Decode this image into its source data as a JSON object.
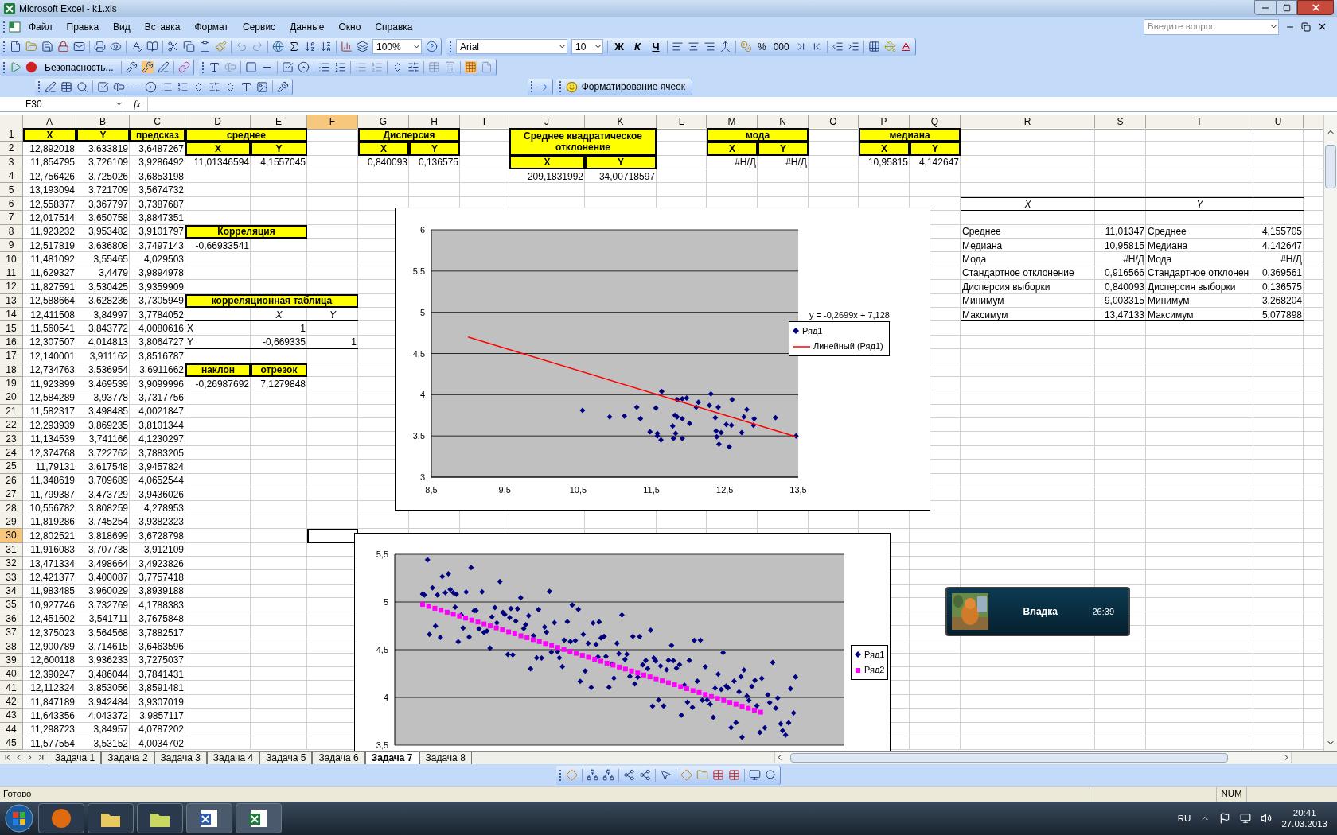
{
  "window": {
    "title": "Microsoft Excel - k1.xls"
  },
  "menu": [
    "Файл",
    "Правка",
    "Вид",
    "Вставка",
    "Формат",
    "Сервис",
    "Данные",
    "Окно",
    "Справка"
  ],
  "help_field": {
    "placeholder": "Введите вопрос"
  },
  "toolbar": {
    "zoom": "100%",
    "font": "Arial",
    "font_size": "10",
    "format_buttons": [
      "Ж",
      "К",
      "Ч"
    ],
    "number_buttons": [
      "%",
      "000"
    ],
    "security": "Безопасность...",
    "task_pane": "Форматирование ячеек"
  },
  "formula_bar": {
    "name_box": "F30",
    "label": "fx"
  },
  "columns": [
    {
      "label": "A",
      "selected": false
    },
    {
      "label": "B",
      "selected": false
    },
    {
      "label": "C",
      "selected": false
    },
    {
      "label": "D",
      "selected": false
    },
    {
      "label": "E",
      "selected": false
    },
    {
      "label": "F",
      "selected": true
    },
    {
      "label": "G",
      "selected": false
    },
    {
      "label": "H",
      "selected": false
    },
    {
      "label": "I",
      "selected": false
    },
    {
      "label": "J",
      "selected": false
    },
    {
      "label": "K",
      "selected": false
    },
    {
      "label": "L",
      "selected": false
    },
    {
      "label": "M",
      "selected": false
    },
    {
      "label": "N",
      "selected": false
    },
    {
      "label": "O",
      "selected": false
    },
    {
      "label": "P",
      "selected": false
    },
    {
      "label": "Q",
      "selected": false
    },
    {
      "label": "R",
      "selected": false
    },
    {
      "label": "S",
      "selected": false
    },
    {
      "label": "T",
      "selected": false
    },
    {
      "label": "U",
      "selected": false
    }
  ],
  "row_numbers": [
    {
      "label": "1",
      "selected": false
    },
    {
      "label": "2",
      "selected": false
    },
    {
      "label": "3",
      "selected": false
    },
    {
      "label": "4",
      "selected": false
    },
    {
      "label": "5",
      "selected": false
    },
    {
      "label": "6",
      "selected": false
    },
    {
      "label": "7",
      "selected": false
    },
    {
      "label": "8",
      "selected": false
    },
    {
      "label": "9",
      "selected": false
    },
    {
      "label": "10",
      "selected": false
    },
    {
      "label": "11",
      "selected": false
    },
    {
      "label": "12",
      "selected": false
    },
    {
      "label": "13",
      "selected": false
    },
    {
      "label": "14",
      "selected": false
    },
    {
      "label": "15",
      "selected": false
    },
    {
      "label": "16",
      "selected": false
    },
    {
      "label": "17",
      "selected": false
    },
    {
      "label": "18",
      "selected": false
    },
    {
      "label": "19",
      "selected": false
    },
    {
      "label": "20",
      "selected": false
    },
    {
      "label": "21",
      "selected": false
    },
    {
      "label": "22",
      "selected": false
    },
    {
      "label": "23",
      "selected": false
    },
    {
      "label": "24",
      "selected": false
    },
    {
      "label": "25",
      "selected": false
    },
    {
      "label": "26",
      "selected": false
    },
    {
      "label": "27",
      "selected": false
    },
    {
      "label": "28",
      "selected": false
    },
    {
      "label": "29",
      "selected": false
    },
    {
      "label": "30",
      "selected": true
    },
    {
      "label": "31",
      "selected": false
    },
    {
      "label": "32",
      "selected": false
    },
    {
      "label": "33",
      "selected": false
    },
    {
      "label": "34",
      "selected": false
    },
    {
      "label": "35",
      "selected": false
    },
    {
      "label": "36",
      "selected": false
    },
    {
      "label": "37",
      "selected": false
    },
    {
      "label": "38",
      "selected": false
    },
    {
      "label": "39",
      "selected": false
    },
    {
      "label": "40",
      "selected": false
    },
    {
      "label": "41",
      "selected": false
    },
    {
      "label": "42",
      "selected": false
    },
    {
      "label": "43",
      "selected": false
    },
    {
      "label": "44",
      "selected": false
    },
    {
      "label": "45",
      "selected": false
    }
  ],
  "data_table": {
    "headers": [
      "X",
      "Y",
      "предсказ"
    ],
    "rows": [
      [
        "12,892018",
        "3,633819",
        "3,6487267"
      ],
      [
        "11,854795",
        "3,726109",
        "3,9286492"
      ],
      [
        "12,756426",
        "3,725026",
        "3,6853198"
      ],
      [
        "13,193094",
        "3,721709",
        "3,5674732"
      ],
      [
        "12,558377",
        "3,367797",
        "3,7387687"
      ],
      [
        "12,017514",
        "3,650758",
        "3,8847351"
      ],
      [
        "11,923232",
        "3,953482",
        "3,9101797"
      ],
      [
        "12,517819",
        "3,636808",
        "3,7497143"
      ],
      [
        "11,481092",
        "3,55465",
        "4,029503"
      ],
      [
        "11,629327",
        "3,4479",
        "3,9894978"
      ],
      [
        "11,827591",
        "3,530425",
        "3,9359909"
      ],
      [
        "12,588664",
        "3,628236",
        "3,7305949"
      ],
      [
        "12,411508",
        "3,84997",
        "3,7784052"
      ],
      [
        "11,560541",
        "3,843772",
        "4,0080616"
      ],
      [
        "12,307507",
        "4,014813",
        "3,8064727"
      ],
      [
        "12,140001",
        "3,911162",
        "3,8516787"
      ],
      [
        "12,734763",
        "3,536954",
        "3,6911662"
      ],
      [
        "11,923899",
        "3,469539",
        "3,9099996"
      ],
      [
        "12,584289",
        "3,93778",
        "3,7317756"
      ],
      [
        "11,582317",
        "3,498485",
        "4,0021847"
      ],
      [
        "12,293939",
        "3,869235",
        "3,8101344"
      ],
      [
        "11,134539",
        "3,741166",
        "4,1230297"
      ],
      [
        "12,374768",
        "3,722762",
        "3,7883205"
      ],
      [
        "11,79131",
        "3,617548",
        "3,9457824"
      ],
      [
        "11,348619",
        "3,709689",
        "4,0652544"
      ],
      [
        "11,799387",
        "3,473729",
        "3,9436026"
      ],
      [
        "10,556782",
        "3,808259",
        "4,278953"
      ],
      [
        "11,819286",
        "3,745254",
        "3,9382323"
      ],
      [
        "12,802521",
        "3,818699",
        "3,6728798"
      ],
      [
        "11,916083",
        "3,707738",
        "3,912109"
      ],
      [
        "13,471334",
        "3,498664",
        "3,4923826"
      ],
      [
        "12,421377",
        "3,400087",
        "3,7757418"
      ],
      [
        "11,983485",
        "3,960029",
        "3,8939188"
      ],
      [
        "10,927746",
        "3,732769",
        "4,1788383"
      ],
      [
        "12,451602",
        "3,541711",
        "3,7675848"
      ],
      [
        "12,375023",
        "3,564568",
        "3,7882517"
      ],
      [
        "12,900789",
        "3,714615",
        "3,6463596"
      ],
      [
        "12,600118",
        "3,936233",
        "3,7275037"
      ],
      [
        "12,390247",
        "3,486044",
        "3,7841431"
      ],
      [
        "12,112324",
        "3,853056",
        "3,8591481"
      ],
      [
        "11,847189",
        "3,942484",
        "3,9307019"
      ],
      [
        "11,643356",
        "4,043372",
        "3,9857117"
      ],
      [
        "11,298723",
        "3,84957",
        "4,0787202"
      ],
      [
        "11,577554",
        "3,53152",
        "4,0034702"
      ]
    ]
  },
  "mean": {
    "title": "среднее",
    "headers": [
      "X",
      "Y"
    ],
    "values": [
      "11,01346594",
      "4,1557045"
    ]
  },
  "variance": {
    "title": "Дисперсия",
    "headers": [
      "X",
      "Y"
    ],
    "values": [
      "0,840093",
      "0,136575"
    ]
  },
  "std_deviation": {
    "title": "Среднее квадратическое отклонение",
    "headers": [
      "X",
      "Y"
    ],
    "values": [
      "209,1831992",
      "34,00718597"
    ]
  },
  "mode": {
    "title": "мода",
    "headers": [
      "X",
      "Y"
    ],
    "values": [
      "#Н/Д",
      "#Н/Д"
    ]
  },
  "median": {
    "title": "медиана",
    "headers": [
      "X",
      "Y"
    ],
    "values": [
      "10,95815",
      "4,142647"
    ]
  },
  "correlation": {
    "title": "Корреляция",
    "value": "-0,66933541"
  },
  "correlation_table": {
    "title": "корреляционная таблица",
    "headers": [
      "X",
      "Y"
    ],
    "rows": [
      {
        "label": "X",
        "values": [
          "1"
        ]
      },
      {
        "label": "Y",
        "values": [
          "-0,669335",
          "1"
        ]
      }
    ]
  },
  "regression": {
    "headers": [
      "наклон",
      "отрезок"
    ],
    "values": [
      "-0,26987692",
      "7,1279848"
    ]
  },
  "stats_table": {
    "headers": [
      "X",
      "Y"
    ],
    "rows": [
      [
        "Среднее",
        "11,01347",
        "Среднее",
        "4,155705"
      ],
      [
        "Медиана",
        "10,95815",
        "Медиана",
        "4,142647"
      ],
      [
        "Мода",
        "#Н/Д",
        "Мода",
        "#Н/Д"
      ],
      [
        "Стандартное отклонение",
        "0,916566",
        "Стандартное отклонен",
        "0,369561"
      ],
      [
        "Дисперсия выборки",
        "0,840093",
        "Дисперсия выборки",
        "0,136575"
      ],
      [
        "Минимум",
        "9,003315",
        "Минимум",
        "3,268204"
      ],
      [
        "Максимум",
        "13,47133",
        "Максимум",
        "5,077898"
      ]
    ]
  },
  "charts": [
    {
      "chart_data": {
        "type": "scatter",
        "x": [
          12.89,
          11.85,
          12.76,
          13.19,
          12.56,
          12.02,
          11.92,
          12.52,
          11.48,
          11.63,
          11.83,
          12.59,
          12.41,
          11.56,
          12.31,
          12.14,
          12.73,
          11.92,
          11.58,
          12.29,
          11.13,
          12.37,
          11.79,
          11.35,
          11.8,
          10.56,
          11.82,
          12.8,
          11.92,
          13.47,
          12.42,
          11.98,
          10.93,
          12.45,
          12.38,
          12.9,
          12.6,
          12.39,
          12.11,
          11.85,
          11.64,
          11.3,
          11.58
        ],
        "series": [
          {
            "name": "Ряд1",
            "color": "#000080",
            "values": [
              3.63,
              3.73,
              3.73,
              3.72,
              3.37,
              3.65,
              3.95,
              3.64,
              3.55,
              3.45,
              3.53,
              3.63,
              3.85,
              3.84,
              4.01,
              3.91,
              3.54,
              3.47,
              3.5,
              3.87,
              3.74,
              3.72,
              3.62,
              3.71,
              3.47,
              3.81,
              3.75,
              3.82,
              3.71,
              3.5,
              3.4,
              3.96,
              3.73,
              3.54,
              3.56,
              3.71,
              3.94,
              3.49,
              3.85,
              3.94,
              4.04,
              3.85,
              3.53
            ]
          },
          {
            "name": "Линейный (Ряд1)",
            "color": "#ff0000",
            "type": "line",
            "x": [
              9,
              13.47
            ],
            "values": [
              4.7,
              3.49
            ]
          }
        ],
        "xlim": [
          8.5,
          13.5
        ],
        "ylim": [
          3,
          6
        ],
        "xticks": [
          {
            "value": 8.5,
            "label": "8,5"
          },
          {
            "value": 9.5,
            "label": "9,5"
          },
          {
            "value": 10.5,
            "label": "10,5"
          },
          {
            "value": 11.5,
            "label": "11,5"
          },
          {
            "value": 12.5,
            "label": "12,5"
          },
          {
            "value": 13.5,
            "label": "13,5"
          }
        ],
        "yticks": [
          {
            "value": 6,
            "label": "6"
          },
          {
            "value": 5.5,
            "label": "5,5"
          },
          {
            "value": 5,
            "label": "5"
          },
          {
            "value": 4.5,
            "label": "4,5"
          },
          {
            "value": 4,
            "label": "4"
          },
          {
            "value": 3.5,
            "label": "3,5"
          },
          {
            "value": 3,
            "label": "3"
          }
        ],
        "annotations": [
          {
            "text": "y = -0,2699x + 7,128"
          }
        ],
        "grid": true,
        "legend": true
      }
    },
    {
      "y_labels": [
        "5,5",
        "5",
        "4,5",
        "4",
        "3,5"
      ],
      "legend": [
        {
          "name": "Ряд1",
          "color": "#000080",
          "kind": "diamond"
        },
        {
          "name": "Ряд2",
          "color": "#ff00ff",
          "kind": "square"
        }
      ]
    }
  ],
  "media_widget": {
    "title": "Владка",
    "time": "26:39"
  },
  "sheet_tabs": [
    {
      "label": "Задача 1",
      "selected": false
    },
    {
      "label": "Задача 2",
      "selected": false
    },
    {
      "label": "Задача 3",
      "selected": false
    },
    {
      "label": "Задача 4",
      "selected": false
    },
    {
      "label": "Задача 5",
      "selected": false
    },
    {
      "label": "Задача 6",
      "selected": false
    },
    {
      "label": "Задача 7",
      "selected": true
    },
    {
      "label": "Задача 8",
      "selected": false
    }
  ],
  "status_bar": {
    "status": "Готово",
    "indicator": "NUM"
  },
  "taskbar": {
    "language": "RU",
    "time": "20:41",
    "date": "27.03.2013"
  }
}
